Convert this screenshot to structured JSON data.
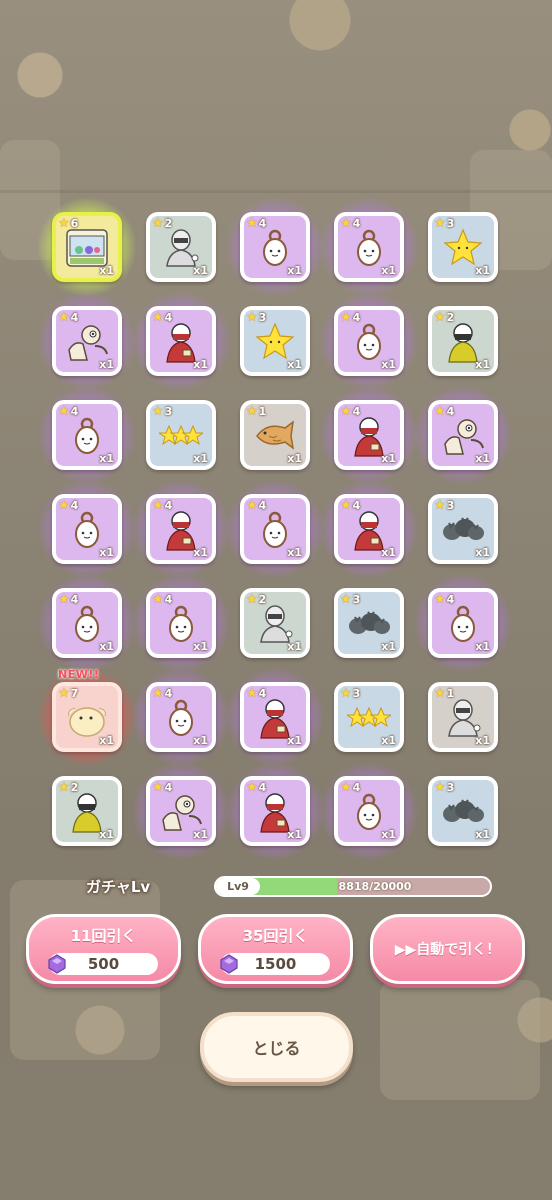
{
  "cards": [
    {
      "rarity": 6,
      "stars": "6",
      "count": "x1",
      "icon": "ufo-catcher-icon",
      "is_new": false
    },
    {
      "rarity": 2,
      "stars": "2",
      "count": "x1",
      "icon": "knight-icon",
      "is_new": false
    },
    {
      "rarity": 4,
      "stars": "4",
      "count": "x1",
      "icon": "mirror-creature-icon",
      "is_new": false
    },
    {
      "rarity": 4,
      "stars": "4",
      "count": "x1",
      "icon": "mirror-creature-icon",
      "is_new": false
    },
    {
      "rarity": 3,
      "stars": "3",
      "count": "x1",
      "icon": "star-icon",
      "is_new": false
    },
    {
      "rarity": 4,
      "stars": "4",
      "count": "x1",
      "icon": "muscle-man-icon",
      "is_new": false
    },
    {
      "rarity": 4,
      "stars": "4",
      "count": "x1",
      "icon": "red-ninja-icon",
      "is_new": false
    },
    {
      "rarity": 3,
      "stars": "3",
      "count": "x1",
      "icon": "star-icon",
      "is_new": false
    },
    {
      "rarity": 4,
      "stars": "4",
      "count": "x1",
      "icon": "mirror-creature-icon",
      "is_new": false
    },
    {
      "rarity": 2,
      "stars": "2",
      "count": "x1",
      "icon": "yellow-ninja-icon",
      "is_new": false
    },
    {
      "rarity": 4,
      "stars": "4",
      "count": "x1",
      "icon": "mirror-creature-icon",
      "is_new": false
    },
    {
      "rarity": 3,
      "stars": "3",
      "count": "x1",
      "icon": "three-stars-icon",
      "is_new": false
    },
    {
      "rarity": 1,
      "stars": "1",
      "count": "x1",
      "icon": "taiyaki-icon",
      "is_new": false
    },
    {
      "rarity": 4,
      "stars": "4",
      "count": "x1",
      "icon": "red-ninja-icon",
      "is_new": false
    },
    {
      "rarity": 4,
      "stars": "4",
      "count": "x1",
      "icon": "muscle-man-icon",
      "is_new": false
    },
    {
      "rarity": 4,
      "stars": "4",
      "count": "x1",
      "icon": "mirror-creature-icon",
      "is_new": false
    },
    {
      "rarity": 4,
      "stars": "4",
      "count": "x1",
      "icon": "red-ninja-icon",
      "is_new": false
    },
    {
      "rarity": 4,
      "stars": "4",
      "count": "x1",
      "icon": "mirror-creature-icon",
      "is_new": false
    },
    {
      "rarity": 4,
      "stars": "4",
      "count": "x1",
      "icon": "red-ninja-icon",
      "is_new": false
    },
    {
      "rarity": 3,
      "stars": "3",
      "count": "x1",
      "icon": "grey-blobs-icon",
      "is_new": false
    },
    {
      "rarity": 4,
      "stars": "4",
      "count": "x1",
      "icon": "mirror-creature-icon",
      "is_new": false
    },
    {
      "rarity": 4,
      "stars": "4",
      "count": "x1",
      "icon": "mirror-creature-icon",
      "is_new": false
    },
    {
      "rarity": 2,
      "stars": "2",
      "count": "x1",
      "icon": "knight-icon",
      "is_new": false
    },
    {
      "rarity": 3,
      "stars": "3",
      "count": "x1",
      "icon": "grey-blobs-icon",
      "is_new": false
    },
    {
      "rarity": 4,
      "stars": "4",
      "count": "x1",
      "icon": "mirror-creature-icon",
      "is_new": false
    },
    {
      "rarity": 7,
      "stars": "7",
      "count": "x1",
      "icon": "cream-creature-icon",
      "is_new": true,
      "new_label": "NEW!!"
    },
    {
      "rarity": 4,
      "stars": "4",
      "count": "x1",
      "icon": "mirror-creature-icon",
      "is_new": false
    },
    {
      "rarity": 4,
      "stars": "4",
      "count": "x1",
      "icon": "red-ninja-icon",
      "is_new": false
    },
    {
      "rarity": 3,
      "stars": "3",
      "count": "x1",
      "icon": "three-stars-icon",
      "is_new": false
    },
    {
      "rarity": 1,
      "stars": "1",
      "count": "x1",
      "icon": "sketch-knight-icon",
      "is_new": false
    },
    {
      "rarity": 2,
      "stars": "2",
      "count": "x1",
      "icon": "yellow-ninja-icon",
      "is_new": false
    },
    {
      "rarity": 4,
      "stars": "4",
      "count": "x1",
      "icon": "muscle-man-icon",
      "is_new": false
    },
    {
      "rarity": 4,
      "stars": "4",
      "count": "x1",
      "icon": "red-ninja-icon",
      "is_new": false
    },
    {
      "rarity": 4,
      "stars": "4",
      "count": "x1",
      "icon": "mirror-creature-icon",
      "is_new": false
    },
    {
      "rarity": 3,
      "stars": "3",
      "count": "x1",
      "icon": "grey-blobs-icon",
      "is_new": false
    }
  ],
  "level": {
    "label": "ガチャLv",
    "level_text": "Lv9",
    "progress_text": "8818/20000",
    "progress_fraction": 0.441
  },
  "buttons": {
    "draw11": {
      "label": "11回引く",
      "cost": "500"
    },
    "draw35": {
      "label": "35回引く",
      "cost": "1500"
    },
    "auto": {
      "label": "▶▶自動で引く！"
    },
    "close": {
      "label": "とじる"
    }
  },
  "colors": {
    "rarity_4_bg": "#dcb8ef",
    "rarity_3_bg": "#c8d8e4",
    "rarity_2_bg": "#ccd7cf",
    "rarity_1_bg": "#d6d0cb",
    "rarity_6_border": "#e8f04a",
    "rarity_7_glow": "#ff5050",
    "button_pink": "#f58aa6",
    "progress_green": "#93d97a"
  }
}
